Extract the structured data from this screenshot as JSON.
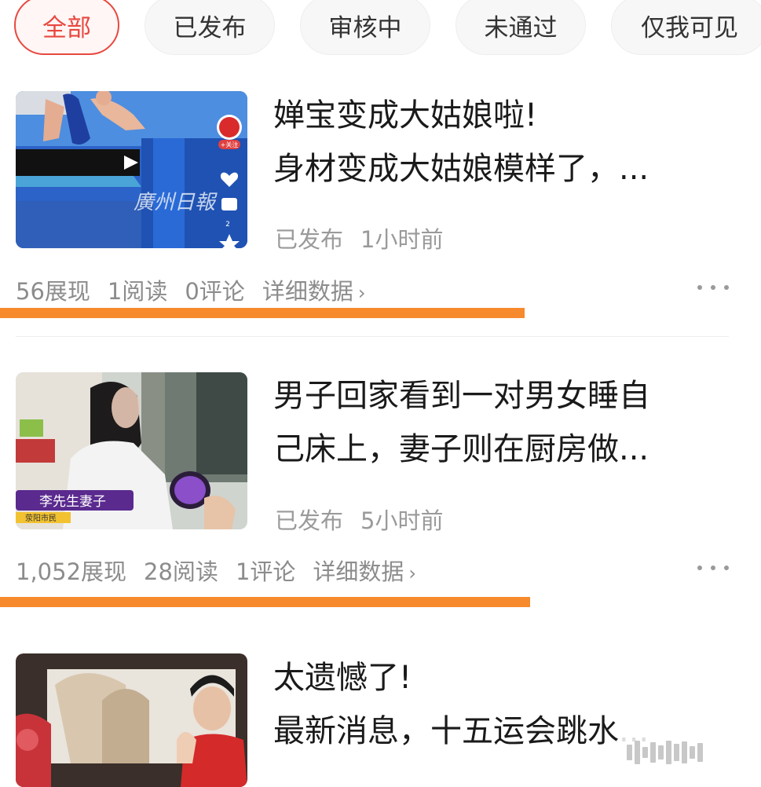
{
  "tabs": [
    {
      "label": "全部",
      "active": true
    },
    {
      "label": "已发布",
      "active": false
    },
    {
      "label": "审核中",
      "active": false
    },
    {
      "label": "未通过",
      "active": false
    },
    {
      "label": "仅我可见",
      "active": false
    }
  ],
  "articles": [
    {
      "title_line1": "婵宝变成大姑娘啦!",
      "title_line2": "身材变成大姑娘模样了，...",
      "status": "已发布",
      "time": "1小时前",
      "impressions": "56展现",
      "reads": "1阅读",
      "comments": "0评论",
      "detail": "详细数据",
      "thumb_watermark": "廣州日報",
      "thumb_badge": "+关注",
      "thumb_count": "2"
    },
    {
      "title_line1": "男子回家看到一对男女睡自",
      "title_line2": "己床上，妻子则在厨房做...",
      "status": "已发布",
      "time": "5小时前",
      "impressions": "1,052展现",
      "reads": "28阅读",
      "comments": "1评论",
      "detail": "详细数据",
      "thumb_caption": "李先生妻子",
      "thumb_subcaption": "荥阳市民"
    },
    {
      "title_line1": "太遗憾了!",
      "title_line2": "最新消息，十五运会跳水..."
    }
  ],
  "colors": {
    "accent": "#e8483f",
    "underline": "#f78a2c",
    "muted_text": "#9a9a9a"
  },
  "icons": {
    "more": "more-horizontal-icon",
    "chevron": "chevron-right-icon"
  }
}
